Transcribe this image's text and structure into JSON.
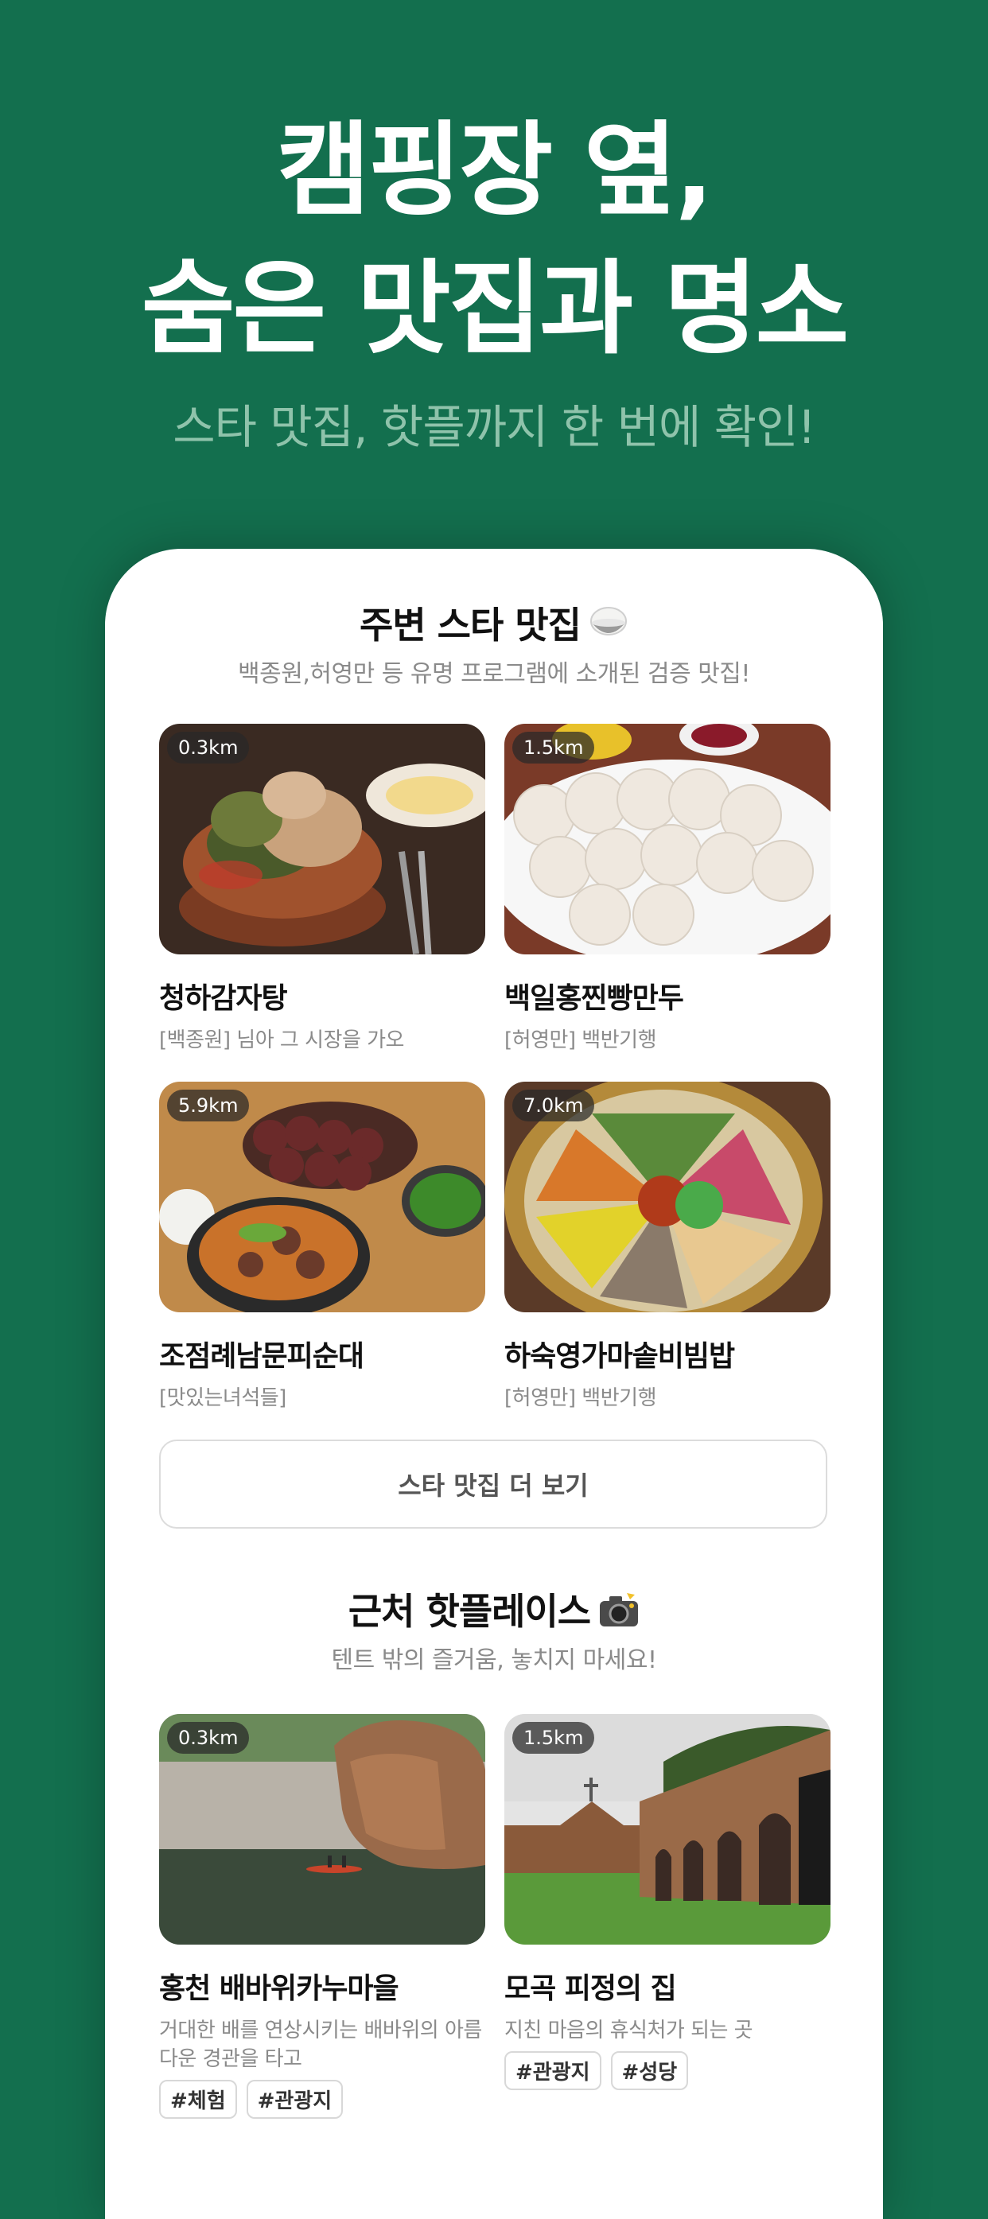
{
  "hero": {
    "title_line1": "캠핑장 옆,",
    "title_line2": "숨은 맛집과 명소",
    "subtitle": "스타 맛집, 핫플까지 한 번에 확인!"
  },
  "star_section": {
    "title": "주변 스타 맛집",
    "title_icon": "rice-bowl-icon",
    "subtitle": "백종원,허영만 등 유명 프로그램에 소개된 검증 맛집!",
    "cards": [
      {
        "distance": "0.3km",
        "name": "청하감자탕",
        "desc": "[백종원] 님아 그 시장을 가오"
      },
      {
        "distance": "1.5km",
        "name": "백일홍찐빵만두",
        "desc": "[허영만] 백반기행"
      },
      {
        "distance": "5.9km",
        "name": "조점례남문피순대",
        "desc": "[맛있는녀석들]"
      },
      {
        "distance": "7.0km",
        "name": "하숙영가마솥비빔밥",
        "desc": "[허영만] 백반기행"
      }
    ],
    "more_button": "스타 맛집 더 보기"
  },
  "hot_section": {
    "title": "근처 핫플레이스",
    "title_icon": "camera-flash-icon",
    "subtitle": "텐트 밖의 즐거움, 놓치지 마세요!",
    "cards": [
      {
        "distance": "0.3km",
        "name": "홍천 배바위카누마을",
        "desc": "거대한 배를 연상시키는 배바위의 아름다운 경관을 타고",
        "tags": [
          "#체험",
          "#관광지"
        ]
      },
      {
        "distance": "1.5km",
        "name": "모곡 피정의 집",
        "desc": "지친 마음의 휴식처가 되는 곳",
        "tags": [
          "#관광지",
          "#성당"
        ]
      }
    ]
  },
  "colors": {
    "background": "#136f4e",
    "subtitle": "#8fc3ab",
    "card": "#ffffff"
  }
}
